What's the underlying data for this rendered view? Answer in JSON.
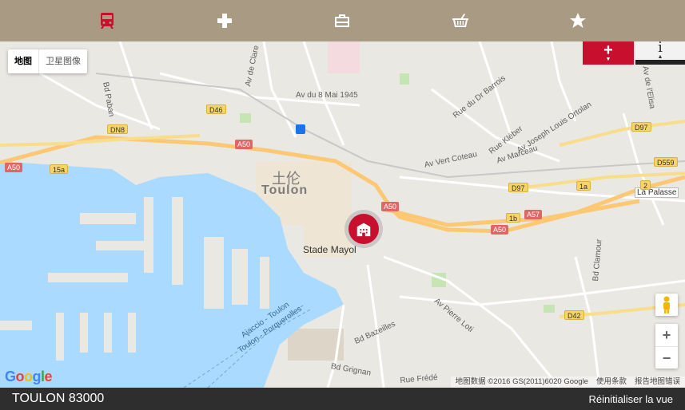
{
  "topbar": {
    "categories": [
      {
        "icon": "train-icon",
        "active": true
      },
      {
        "icon": "medical-cross-icon",
        "active": false
      },
      {
        "icon": "briefcase-icon",
        "active": false
      },
      {
        "icon": "shopping-basket-icon",
        "active": false
      },
      {
        "icon": "star-icon",
        "active": false
      }
    ]
  },
  "map": {
    "type_controls": {
      "map": "地图",
      "satellite": "卫星图像"
    },
    "add_button": "+",
    "info_button": "i",
    "zoom_in": "+",
    "zoom_out": "−",
    "labels": {
      "city_cn": "土伦",
      "city": "Toulon",
      "stade": "Stade Mayol",
      "av_8mai": "Av du 8 Mai 1945",
      "av_clare": "Av de Clare",
      "rue_barrois": "Rue du Dr Barrois",
      "rue_kleber": "Rue Kléber",
      "av_ortolan": "Av Joseph Louis Ortolan",
      "av_marceau": "Av Marceau",
      "av_vert_coteau": "Av Vert Coteau",
      "av_elisa": "Av de l'Elisa",
      "la_palasse": "La Palasse",
      "bd_clamour": "Bd Clamour",
      "av_pierre_loti": "Av Pierre Loti",
      "bd_bazeilles": "Bd Bazeilles",
      "bd_grignan": "Bd Grignan",
      "ajaccio_ferry": "Ajaccio - Toulon",
      "porquerolles_ferry": "Toulon - Porquerolles",
      "bd_paban": "Bd Paban",
      "rue_frede": "Rue Frédé"
    },
    "shields": {
      "a50_1": "A50",
      "a50_2": "A50",
      "a50_3": "A50",
      "a50_4": "A50",
      "a57": "A57",
      "d46": "D46",
      "dn8": "DN8",
      "15a": "15a",
      "d97_1": "D97",
      "d97_2": "D97",
      "d559": "D559",
      "d42": "D42",
      "1a": "1a",
      "1b": "1b",
      "2": "2"
    },
    "google": "Google",
    "attribution": {
      "data": "地图数据 ©2016 GS(2011)6020 Google",
      "terms": "使用条款",
      "report": "报告地图错误"
    },
    "colors": {
      "water": "#aadaff",
      "highway": "#fcc873",
      "accent": "#c8102e"
    }
  },
  "footer": {
    "city": "TOULON 83000",
    "reset": "Réinitialiser la vue"
  }
}
